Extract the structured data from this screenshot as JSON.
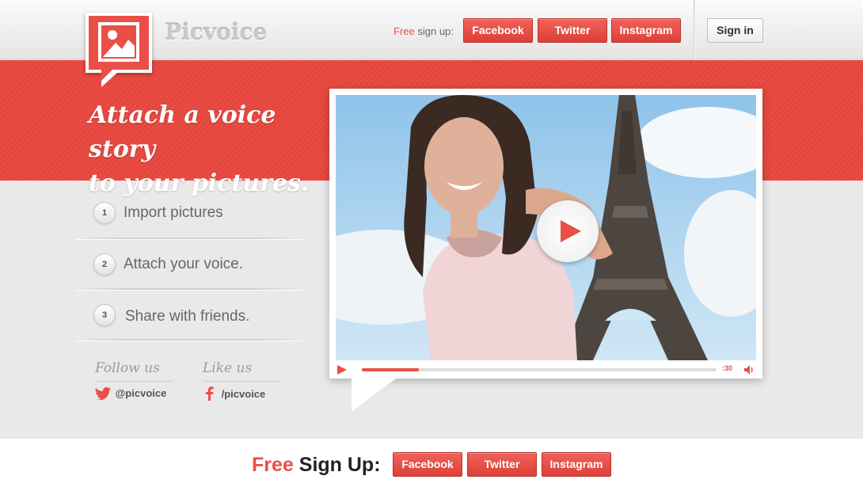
{
  "brand": {
    "name": "Picvoice"
  },
  "header": {
    "free": "Free",
    "signup_text": "sign up:",
    "buttons": [
      "Facebook",
      "Twitter",
      "Instagram"
    ],
    "signin": "Sign in"
  },
  "hero": {
    "tagline_line1": "Attach a voice story",
    "tagline_line2": "to your pictures."
  },
  "steps": [
    {
      "num": "1",
      "label": "Import pictures"
    },
    {
      "num": "2",
      "label": "Attach your voice."
    },
    {
      "num": "3",
      "label": "Share with friends."
    }
  ],
  "social": {
    "follow_label": "Follow us",
    "follow_handle": "@picvoice",
    "like_label": "Like us",
    "like_handle": "/picvoice"
  },
  "player": {
    "time": ":30",
    "progress": 0.16
  },
  "footer": {
    "free": "Free",
    "signup": "Sign Up:",
    "buttons": [
      "Facebook",
      "Twitter",
      "Instagram"
    ]
  },
  "colors": {
    "accent": "#e94f47",
    "background": "#e9e9e9"
  }
}
